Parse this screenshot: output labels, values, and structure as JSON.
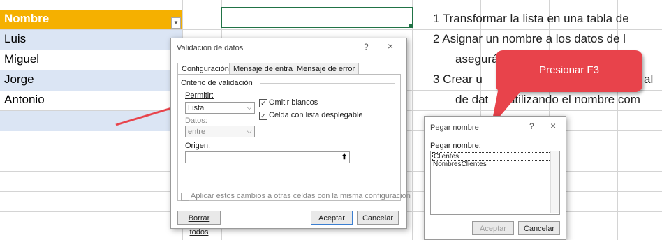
{
  "sheet": {
    "header": "Nombre",
    "names": [
      "Luis",
      "Miguel",
      "Jorge",
      "Antonio"
    ]
  },
  "instructions": {
    "line1": "1 Transformar la lista en una tabla de",
    "line2": "2 Asignar un nombre a los datos de l",
    "line2b": "asegurá",
    "line3": "3 Crear u",
    "line3b": "al",
    "line3c": "de dat",
    "line3d": "s, utilizando el nombre com"
  },
  "validation_dialog": {
    "title": "Validación de datos",
    "help": "?",
    "close": "×",
    "tabs": [
      "Configuración",
      "Mensaje de entrada",
      "Mensaje de error"
    ],
    "section": "Criterio de validación",
    "allow_label": "Permitir:",
    "allow_value": "Lista",
    "ignore_blank": "Omitir blancos",
    "dropdown_cell": "Celda con lista desplegable",
    "data_label": "Datos:",
    "data_value": "entre",
    "source_label": "Origen:",
    "source_value": "",
    "apply_all": "Aplicar estos cambios a otras celdas con la misma configuración",
    "clear_all": "Borrar todos",
    "ok": "Aceptar",
    "cancel": "Cancelar"
  },
  "paste_dialog": {
    "title": "Pegar nombre",
    "help": "?",
    "close": "×",
    "label": "Pegar nombre:",
    "items": [
      "Clientes",
      "NombresClientes"
    ],
    "ok": "Aceptar",
    "cancel": "Cancelar"
  },
  "callout": {
    "text": "Presionar F3"
  },
  "colors": {
    "header": "#f5b000",
    "band": "#dbe5f4",
    "callout": "#e8434b",
    "arrow": "#e8434b"
  }
}
